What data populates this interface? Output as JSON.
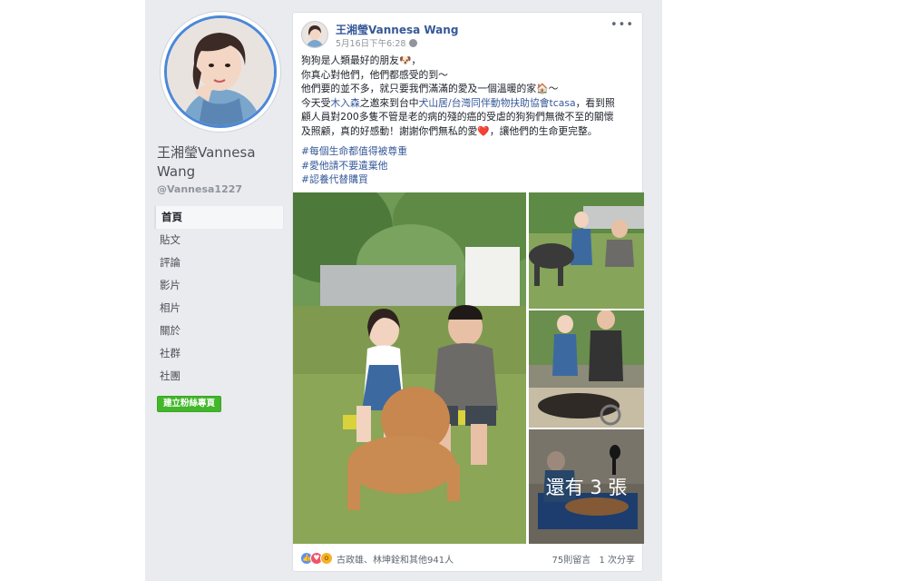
{
  "sidebar": {
    "page_name": "王湘瑩Vannesa Wang",
    "handle": "@Vannesa1227",
    "nav": [
      "首頁",
      "貼文",
      "評論",
      "影片",
      "相片",
      "關於",
      "社群",
      "社團"
    ],
    "create_page_label": "建立粉絲專頁"
  },
  "post": {
    "author": "王湘瑩Vannesa Wang",
    "timestamp": "5月16日下午6:28",
    "lines": {
      "l1": "狗狗是人類最好的朋友🐶，",
      "l2": "你真心對他們，他們都感受的到～",
      "l3": "他們要的並不多，就只要我們滿滿的愛及一個溫暖的家🏠～",
      "l4a": "今天受",
      "l4b": "木入森",
      "l4c": "之邀來到台中",
      "l4d": "犬山居/台灣同伴動物扶助協會tcasa",
      "l4e": "，看到照",
      "l5": "顧人員對200多隻不管是老的病的殘的癌的受虐的狗狗們無微不至的關懷",
      "l6": "及照顧，真的好感動！謝謝你們無私的愛❤️，讓他們的生命更完整。"
    },
    "hashtags": [
      "#每個生命都值得被尊重",
      "#愛他請不要遺棄他",
      "#認養代替購買"
    ],
    "more_photos_label": "還有 3 張",
    "reactions_text": "古政雄、林坤銓和其他941人",
    "comments": "75則留言",
    "shares": "1 次分享"
  },
  "colors": {
    "link": "#365899",
    "profile_ring": "#4a88d8",
    "create_button": "#42b72a",
    "page_background": "#e9ebee"
  },
  "icons": [
    "globe-icon",
    "more-options-icon",
    "like-reaction-icon",
    "love-reaction-icon",
    "wow-reaction-icon"
  ]
}
